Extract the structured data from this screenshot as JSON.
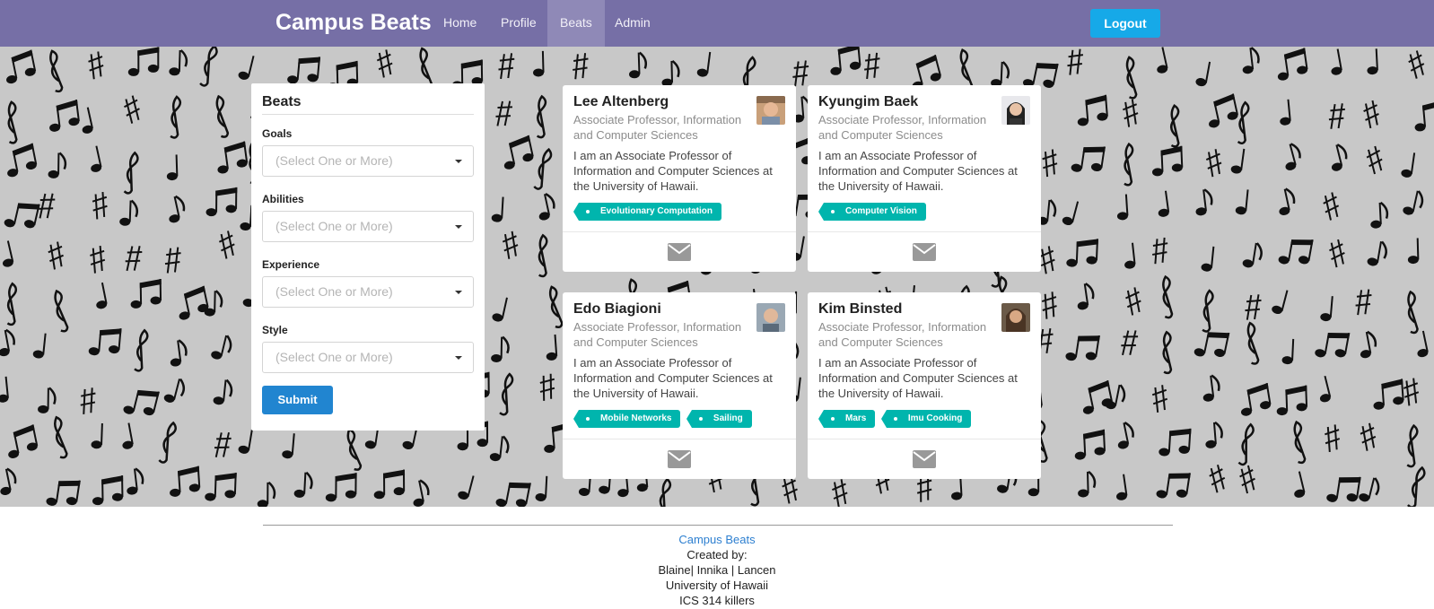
{
  "nav": {
    "brand": "Campus Beats",
    "items": [
      {
        "label": "Home",
        "active": false
      },
      {
        "label": "Profile",
        "active": false
      },
      {
        "label": "Beats",
        "active": true
      },
      {
        "label": "Admin",
        "active": false
      }
    ],
    "logout": "Logout"
  },
  "filter": {
    "title": "Beats",
    "fields": [
      {
        "label": "Goals",
        "placeholder": "(Select One or More)"
      },
      {
        "label": "Abilities",
        "placeholder": "(Select One or More)"
      },
      {
        "label": "Experience",
        "placeholder": "(Select One or More)"
      },
      {
        "label": "Style",
        "placeholder": "(Select One or More)"
      }
    ],
    "submit": "Submit"
  },
  "cards": [
    {
      "name": "Lee Altenberg",
      "title": "Associate Professor, Information and Computer Sciences",
      "bio": "I am an Associate Professor of Information and Computer Sciences at the University of Hawaii.",
      "tags": [
        "Evolutionary Computation"
      ]
    },
    {
      "name": "Kyungim Baek",
      "title": "Associate Professor, Information and Computer Sciences",
      "bio": "I am an Associate Professor of Information and Computer Sciences at the University of Hawaii.",
      "tags": [
        "Computer Vision"
      ]
    },
    {
      "name": "Edo Biagioni",
      "title": "Associate Professor, Information and Computer Sciences",
      "bio": "I am an Associate Professor of Information and Computer Sciences at the University of Hawaii.",
      "tags": [
        "Mobile Networks",
        "Sailing"
      ]
    },
    {
      "name": "Kim Binsted",
      "title": "Associate Professor, Information and Computer Sciences",
      "bio": "I am an Associate Professor of Information and Computer Sciences at the University of Hawaii.",
      "tags": [
        "Mars",
        "Imu Cooking"
      ]
    }
  ],
  "footer": {
    "brand": "Campus Beats",
    "created_by": "Created by:",
    "authors": "Blaine| Innika | Lancen",
    "university": "University of Hawaii",
    "course": "ICS 314 killers"
  },
  "colors": {
    "navbar": "#766fa6",
    "logout": "#16a9e8",
    "submit": "#2185d0",
    "tag": "#00b5ad"
  }
}
